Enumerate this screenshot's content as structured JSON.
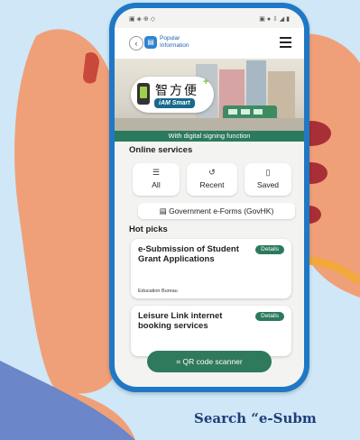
{
  "topbar": {
    "crumb_line1": "Popular",
    "crumb_line2": "Information"
  },
  "banner": {
    "logo_cn": "智方便",
    "logo_en": "iAM Smart",
    "logo_plus": "+",
    "caption": "With digital signing function"
  },
  "online_services": {
    "title": "Online services",
    "tiles": [
      {
        "label": "All",
        "icon": "list-icon"
      },
      {
        "label": "Recent",
        "icon": "history-icon"
      },
      {
        "label": "Saved",
        "icon": "bookmark-icon"
      }
    ],
    "gov_forms": "Government e-Forms (GovHK)"
  },
  "hot_picks": {
    "title": "Hot picks",
    "cards": [
      {
        "title": "e-Submission of Student Grant Applications",
        "details": "Details",
        "dept": "Education Bureau"
      },
      {
        "title": "Leisure Link internet booking services",
        "details": "Details",
        "dept": ""
      }
    ]
  },
  "qr_button": "QR code scanner",
  "caption": "Search “e-Subm",
  "colors": {
    "accent_green": "#2c7a5d",
    "phone_blue": "#1f78c6",
    "caption_blue": "#1f3e78"
  }
}
